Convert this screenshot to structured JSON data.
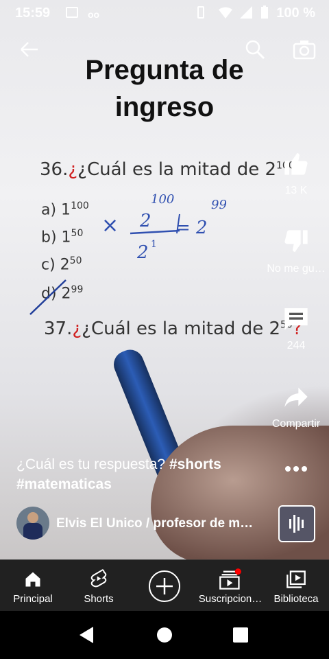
{
  "status_bar": {
    "time": "15:59",
    "battery": "100 %"
  },
  "video": {
    "title_line1": "Pregunta de",
    "title_line2": "ingreso",
    "q36_prefix": "36.",
    "q36_text": "¿Cuál es la mitad de 2",
    "q36_exp": "100",
    "options": [
      {
        "label": "a) 1",
        "exp": "100"
      },
      {
        "label": "b) 1",
        "exp": "50"
      },
      {
        "label": "c) 2",
        "exp": "50"
      },
      {
        "label": "d) 2",
        "exp": "99"
      }
    ],
    "q37_prefix": "37.",
    "q37_text": "¿Cuál es la mitad de 2",
    "q37_exp": "50",
    "q37_end": "?",
    "handwriting_top": "100",
    "handwriting_num": "2",
    "handwriting_den": "2",
    "handwriting_den_exp": "1",
    "handwriting_result": "= 2",
    "handwriting_result_exp": "99",
    "handwriting_times": "×"
  },
  "actions": {
    "like_count": "13 K",
    "dislike_label": "No me gu…",
    "comments_count": "244",
    "share_label": "Compartir"
  },
  "caption": {
    "text": "¿Cuál es tu respuesta? ",
    "tag1": "#shorts",
    "tag2": "#matematicas"
  },
  "channel": {
    "name": "Elvis El Unico / profesor de m…"
  },
  "nav": {
    "items": [
      "Principal",
      "Shorts",
      "",
      "Suscripcion…",
      "Biblioteca"
    ]
  },
  "icons": {
    "back": "arrow-left-icon",
    "search": "search-icon",
    "camera": "camera-icon",
    "like": "thumbs-up-icon",
    "dislike": "thumbs-down-icon",
    "comment": "comment-icon",
    "share": "share-icon",
    "more": "more-icon"
  },
  "colors": {
    "accent_red": "#ff0000",
    "nav_bg": "#212121"
  }
}
